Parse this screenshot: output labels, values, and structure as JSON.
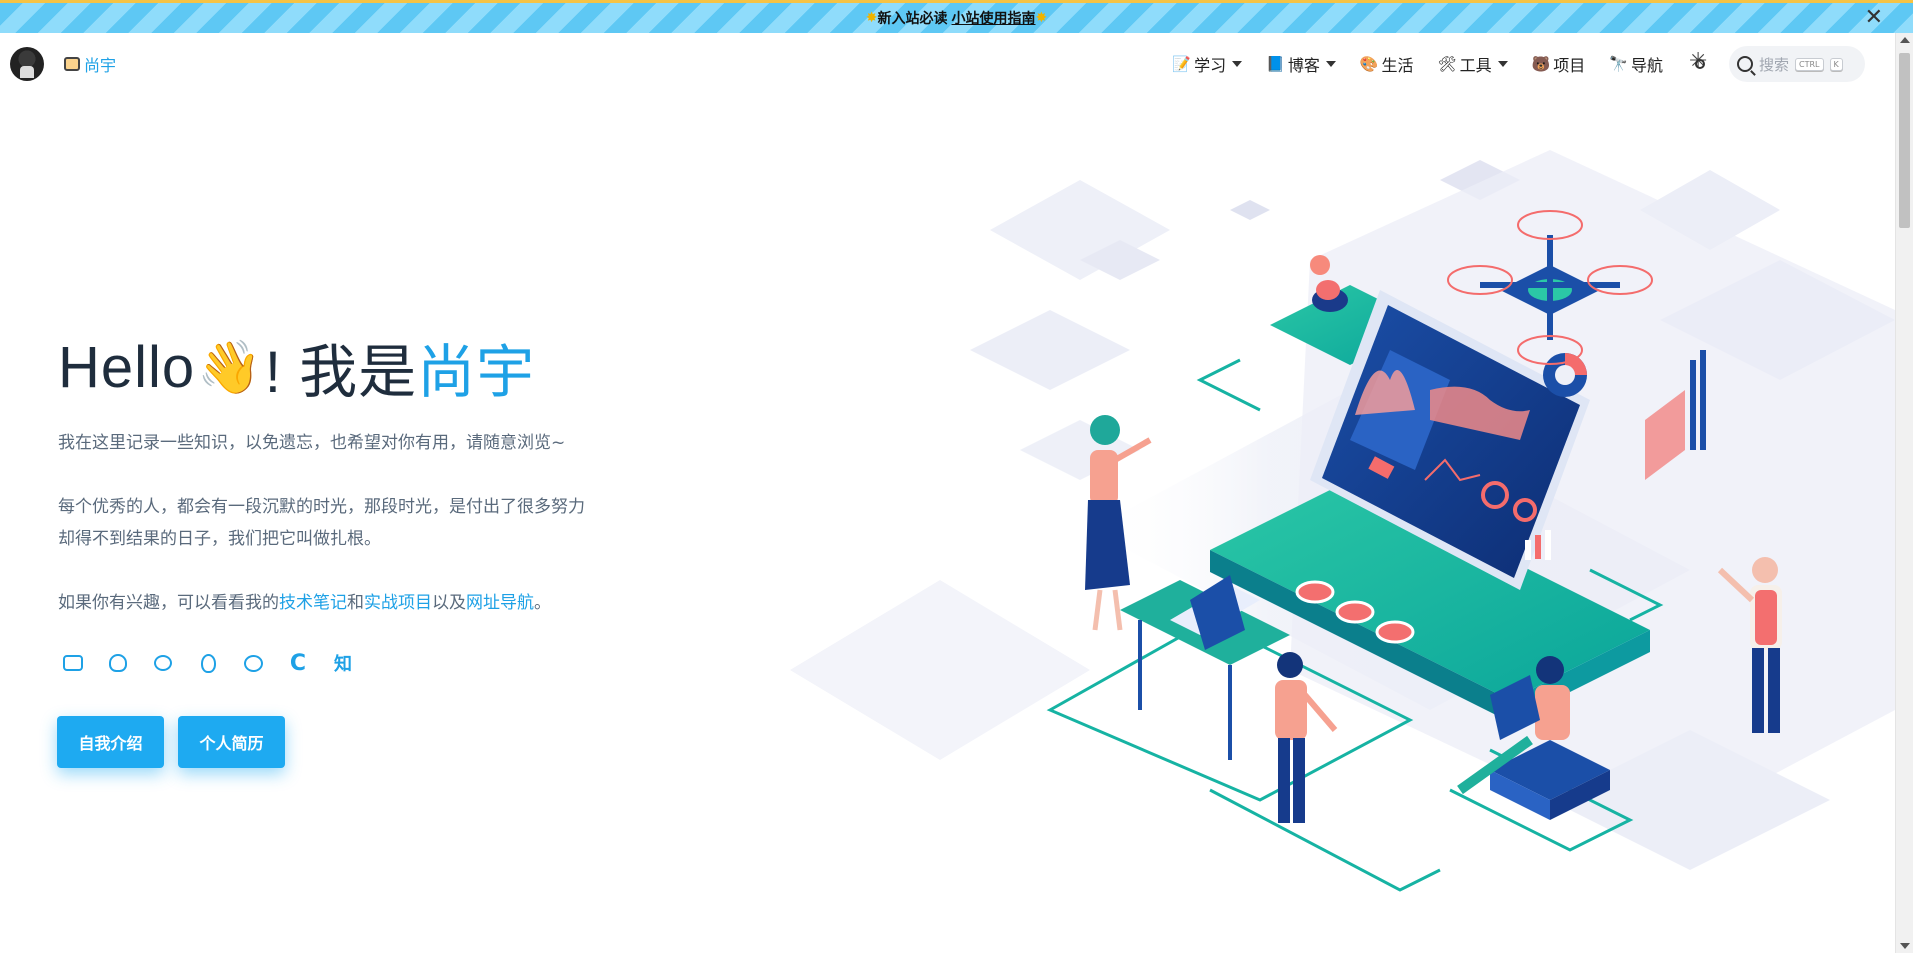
{
  "announcement": {
    "prefix": "新入站必读",
    "link": "小站使用指南",
    "close": "✕"
  },
  "brand": {
    "name": "尚宇"
  },
  "nav": {
    "items": [
      {
        "label": "学习",
        "icon": "memo-icon",
        "dropdown": true
      },
      {
        "label": "博客",
        "icon": "book-icon",
        "dropdown": true
      },
      {
        "label": "生活",
        "icon": "palette-icon",
        "dropdown": false
      },
      {
        "label": "工具",
        "icon": "tools-icon",
        "dropdown": true
      },
      {
        "label": "项目",
        "icon": "bear-icon",
        "dropdown": false
      },
      {
        "label": "导航",
        "icon": "binoculars-icon",
        "dropdown": false
      }
    ],
    "search_placeholder": "搜索",
    "kbd_ctrl": "CTRL",
    "kbd_k": "K"
  },
  "hero": {
    "title_prefix": "Hello",
    "title_wave": "👋",
    "title_mid": "! 我是",
    "title_name": "尚宇",
    "p1": "我在这里记录一些知识，以免遗忘，也希望对你有用，请随意浏览~",
    "p2_line1": "每个优秀的人，都会有一段沉默的时光，那段时光，是付出了很多努力",
    "p2_line2": "却得不到结果的日子，我们把它叫做扎根。",
    "p3_a": "如果你有兴趣，可以看看我的",
    "p3_link1": "技术笔记",
    "p3_b": "和",
    "p3_link2": "实战项目",
    "p3_c": "以及",
    "p3_link3": "网址导航",
    "p3_d": "。",
    "social_zhihu": "知",
    "social_csdn": "C",
    "btn_intro": "自我介绍",
    "btn_resume": "个人简历"
  },
  "colors": {
    "accent": "#1ea1e6",
    "button": "#1eaaf1",
    "text_dark": "#1f2d3d",
    "text_body": "#5a6a7c"
  }
}
